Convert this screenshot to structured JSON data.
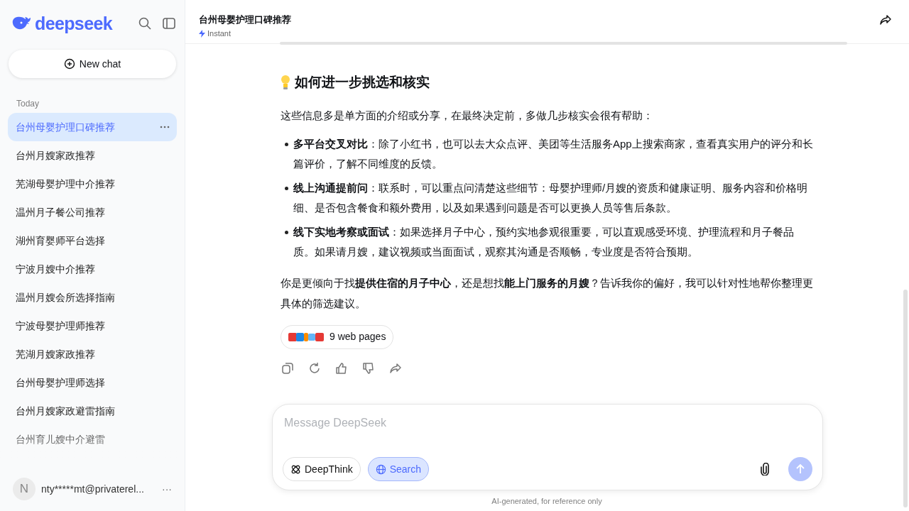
{
  "sidebar": {
    "brand": "deepseek",
    "new_chat": "New chat",
    "section": "Today",
    "items": [
      {
        "label": "台州母婴护理口碑推荐",
        "selected": true
      },
      {
        "label": "台州月嫂家政推荐",
        "selected": false
      },
      {
        "label": "芜湖母婴护理中介推荐",
        "selected": false
      },
      {
        "label": "温州月子餐公司推荐",
        "selected": false
      },
      {
        "label": "湖州育婴师平台选择",
        "selected": false
      },
      {
        "label": "宁波月嫂中介推荐",
        "selected": false
      },
      {
        "label": "温州月嫂会所选择指南",
        "selected": false
      },
      {
        "label": "宁波母婴护理师推荐",
        "selected": false
      },
      {
        "label": "芜湖月嫂家政推荐",
        "selected": false
      },
      {
        "label": "台州母婴护理师选择",
        "selected": false
      },
      {
        "label": "台州月嫂家政避雷指南",
        "selected": false
      },
      {
        "label": "台州育儿嫂中介避雷",
        "selected": false
      }
    ],
    "user": {
      "avatar": "N",
      "email": "nty*****mt@privaterel...",
      "more": "···"
    }
  },
  "header": {
    "title": "台州母婴护理口碑推荐",
    "mode": "Instant"
  },
  "message": {
    "heading": "如何进一步挑选和核实",
    "intro": "这些信息多是单方面的介绍或分享，在最终决定前，多做几步核实会很有帮助：",
    "bullets": [
      "**多平台交叉对比**：除了小红书，也可以去大众点评、美团等生活服务App上搜索商家，查看真实用户的评分和长篇评价，了解不同维度的反馈。",
      "**线上沟通提前问**：联系时，可以重点问清楚这些细节：母婴护理师/月嫂的资质和健康证明、服务内容和价格明细、是否包含餐食和额外费用，以及如果遇到问题是否可以更换人员等售后条款。",
      "**线下实地考察或面试**：如果选择月子中心，预约实地参观很重要，可以直观感受环境、护理流程和月子餐品质。如果请月嫂，建议视频或当面面试，观察其沟通是否顺畅，专业度是否符合预期。"
    ],
    "closing": "你是更倾向于找**提供住宿的月子中心**，还是想找**能上门服务的月嫂**？告诉我你的偏好，我可以针对性地帮你整理更具体的筛选建议。",
    "sources": "9 web pages"
  },
  "composer": {
    "placeholder": "Message DeepSeek",
    "toggles": [
      {
        "label": "DeepThink",
        "kind": "deepthink",
        "selected": false
      },
      {
        "label": "Search",
        "kind": "search",
        "selected": true
      }
    ]
  },
  "footer": "AI-generated, for reference only"
}
